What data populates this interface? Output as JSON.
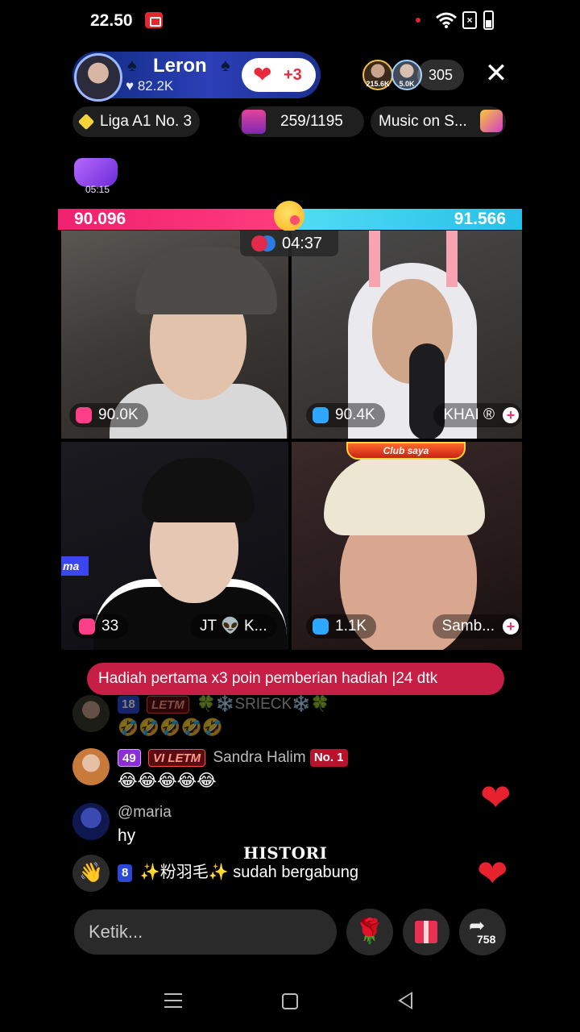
{
  "status_bar": {
    "time": "22.50"
  },
  "host": {
    "name": "Leron",
    "likes": "82.2K",
    "follow_count": "+3"
  },
  "viewers": {
    "count": "305",
    "avatar1_label": "215.6K",
    "avatar2_label": "5.0K"
  },
  "tags": {
    "league": "Liga A1 No. 3",
    "progress": "259/1195",
    "music": "Music on S..."
  },
  "timer_badge": "05:15",
  "battle": {
    "score_left": "90.096",
    "score_right": "91.566",
    "timer": "04:37"
  },
  "cams": [
    {
      "score": "90.0K",
      "name": ""
    },
    {
      "score": "90.4K",
      "name": "KHAI ®"
    },
    {
      "score": "33",
      "name": "JT 👽 K...",
      "side_tag": "ma"
    },
    {
      "score": "1.1K",
      "name": "Samb...",
      "banner": "Club saya"
    }
  ],
  "banner": "Hadiah pertama x3 poin pemberian hadiah |24 dtk",
  "chat": [
    {
      "level": "18",
      "fan": "LETM",
      "user": "🍀❄️SRIECK❄️🍀",
      "message": "🤣🤣🤣🤣🤣"
    },
    {
      "level": "49",
      "fan": "LETM",
      "fan_level": "VI",
      "user": "Sandra Halim",
      "rank": "No. 1",
      "message": "😂😂😂😂😂"
    },
    {
      "user": "@maria",
      "message": "hy"
    },
    {
      "level": "8",
      "user": "✨粉羽毛✨",
      "message": "sudah bergabung"
    }
  ],
  "histori_label": "HISTORI",
  "input": {
    "placeholder": "Ketik..."
  },
  "share_count": "758",
  "colors": {
    "score_left": "#f0206e",
    "score_right": "#27bfe8",
    "banner": "#c61e44",
    "heart": "#e8212f"
  },
  "icons": [
    "rec-icon",
    "wifi-icon",
    "battery-icon",
    "heart-icon",
    "close-icon",
    "diamond-icon",
    "chest-icon",
    "music-icon",
    "gloves-icon",
    "rose-icon",
    "gift-icon",
    "share-icon",
    "wave-icon",
    "nav-menu-icon",
    "nav-home-icon",
    "nav-back-icon"
  ]
}
